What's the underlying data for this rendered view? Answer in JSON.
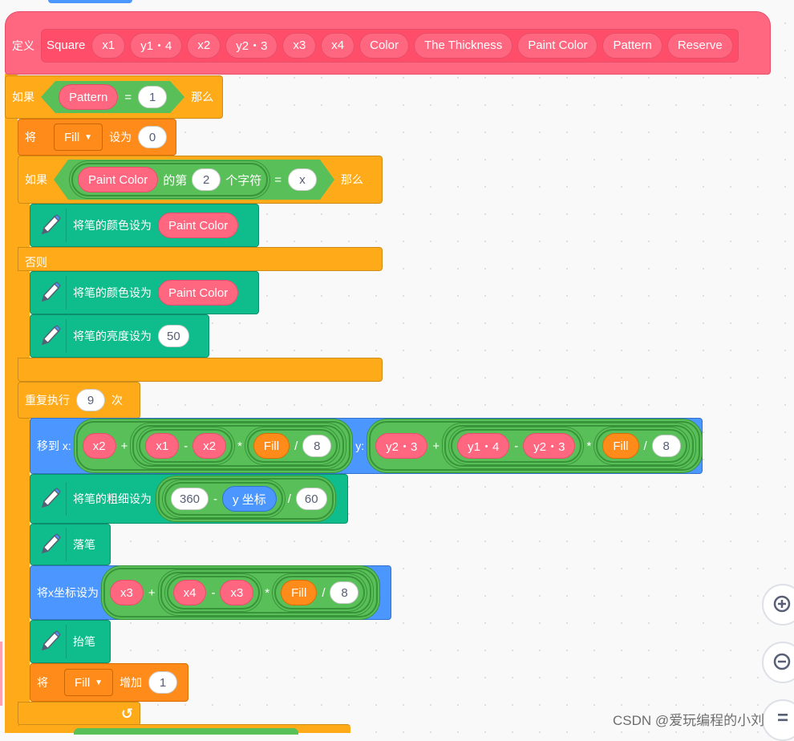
{
  "define": {
    "label": "定义",
    "name": "Square",
    "params": [
      "x1",
      "y1・4",
      "x2",
      "y2・3",
      "x3",
      "x4",
      "Color",
      "The Thickness",
      "Paint Color",
      "Pattern",
      "Reserve"
    ]
  },
  "if1": {
    "label": "如果",
    "var": "Pattern",
    "op": "=",
    "value": "1",
    "then": "那么"
  },
  "set_fill": {
    "label": "将",
    "var": "Fill",
    "setto": "设为",
    "value": "0"
  },
  "if2": {
    "label": "如果",
    "var": "Paint Color",
    "of": "的第",
    "index": "2",
    "char": "个字符",
    "op": "=",
    "value": "x",
    "then": "那么"
  },
  "pen1": {
    "label": "将笔的颜色设为",
    "value": "Paint Color"
  },
  "else": {
    "label": "否则"
  },
  "pen2": {
    "label": "将笔的颜色设为",
    "value": "Paint Color"
  },
  "pen3": {
    "label": "将笔的亮度设为",
    "value": "50"
  },
  "repeat": {
    "label": "重复执行",
    "value": "9",
    "times": "次"
  },
  "goto": {
    "label": "移到 x:",
    "ylabel": "y:",
    "x": {
      "a": "x2",
      "plus": "+",
      "b": "x1",
      "minus": "-",
      "c": "x2",
      "mul": "*",
      "fill": "Fill",
      "div": "/",
      "n": "8"
    },
    "y": {
      "a": "y2・3",
      "plus": "+",
      "b": "y1・4",
      "minus": "-",
      "c": "y2・3",
      "mul": "*",
      "fill": "Fill",
      "div": "/",
      "n": "8"
    }
  },
  "pensize": {
    "label": "将笔的粗细设为",
    "a": "360",
    "minus": "-",
    "ycoord": "y 坐标",
    "div": "/",
    "n": "60"
  },
  "pendown": {
    "label": "落笔"
  },
  "setx": {
    "label": "将x坐标设为",
    "a": "x3",
    "plus": "+",
    "b": "x4",
    "minus": "-",
    "c": "x3",
    "mul": "*",
    "fill": "Fill",
    "div": "/",
    "n": "8"
  },
  "penup": {
    "label": "抬笔"
  },
  "change": {
    "label": "将",
    "var": "Fill",
    "by": "增加",
    "value": "1"
  },
  "loop_arrow": "↺",
  "watermark": "CSDN @爱玩编程的小刘",
  "zoom": {
    "in": "+",
    "out": "−",
    "reset": "="
  },
  "colors": {
    "custom": "#ff6680",
    "control": "#ffab19",
    "variables": "#ff8c1a",
    "pen": "#0fbd8c",
    "motion": "#4c97ff",
    "operators": "#59c059"
  }
}
